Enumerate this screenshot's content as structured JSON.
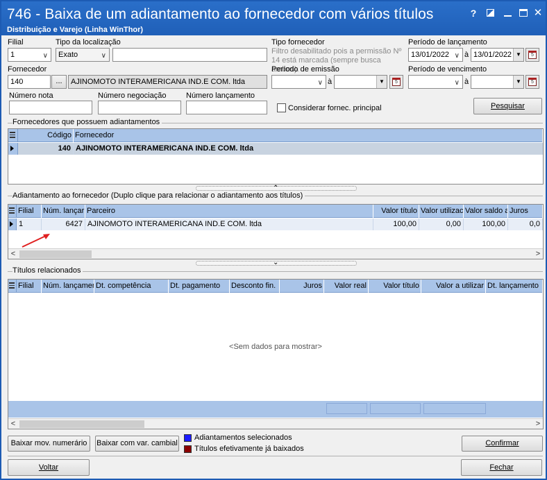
{
  "window": {
    "title": "746 - Baixa de um adiantamento ao fornecedor com vários títulos",
    "subtitle": "Distribuição e Varejo (Linha WinThor)",
    "help_glyph": "?",
    "close_glyph": "✕"
  },
  "filters": {
    "filial_label": "Filial",
    "filial_value": "1",
    "tipo_localizacao_label": "Tipo da localização",
    "tipo_localizacao_value": "Exato",
    "localizacao_value": "",
    "tipo_fornecedor_label": "Tipo fornecedor",
    "tipo_fornecedor_hint": "Filtro desabilitado pois a permissão Nº 14 está marcada (sempre busca ambos).",
    "periodo_lancamento_label": "Período de lançamento",
    "periodo_lancamento_inicio": "13/01/2022",
    "periodo_lancamento_fim": "13/01/2022",
    "a_label": "à",
    "fornecedor_label": "Fornecedor",
    "fornecedor_codigo": "140",
    "ellipsis_button": "...",
    "fornecedor_nome": "AJINOMOTO INTERAMERICANA IND.E COM. ltda",
    "periodo_emissao_label": "Período de emissão",
    "periodo_emissao_inicio": "",
    "periodo_emissao_fim": "",
    "periodo_vencimento_label": "Período de vencimento",
    "periodo_vencimento_inicio": "",
    "periodo_vencimento_fim": "",
    "numero_nota_label": "Número nota",
    "numero_negociacao_label": "Número negociação",
    "numero_lancamento_label": "Número lançamento",
    "considerar_label": "Considerar fornec. principal",
    "pesquisar_button": "Pesquisar"
  },
  "fornecedores": {
    "section_title": "Fornecedores que possuem adiantamentos",
    "columns": [
      "Código",
      "Fornecedor"
    ],
    "rows": [
      {
        "codigo": "140",
        "fornecedor": "AJINOMOTO INTERAMERICANA IND.E COM. ltda"
      }
    ]
  },
  "adiantamentos": {
    "section_title": "Adiantamento ao fornecedor (Duplo clique para relacionar o adiantamento aos títulos)",
    "columns": [
      "Filial",
      "Núm. lançar",
      "Parceiro",
      "Valor título",
      "Valor utilizac",
      "Valor saldo a",
      "Juros"
    ],
    "rows": [
      {
        "filial": "1",
        "num_lancamento": "6427",
        "parceiro": "AJINOMOTO INTERAMERICANA IND.E COM. ltda",
        "valor_titulo": "100,00",
        "valor_utilizado": "0,00",
        "valor_saldo": "100,00",
        "juros": "0,0"
      }
    ]
  },
  "titulos": {
    "section_title": "Títulos relacionados",
    "columns": [
      "Filial",
      "Núm. lançamer",
      "Dt. competência",
      "Dt. pagamento",
      "Desconto fin.",
      "Juros",
      "Valor real",
      "Valor título",
      "Valor a utilizar",
      "Dt. lançamento"
    ],
    "empty_message": "<Sem dados para mostrar>"
  },
  "footer": {
    "baixar_mov_button": "Baixar mov. numerário",
    "baixar_var_button": "Baixar com var. cambial",
    "legend_selected": "Adiantamentos selecionados",
    "legend_baixados": "Títulos efetivamente já baixados",
    "legend_selected_color": "#1a1aff",
    "legend_baixados_color": "#8b0000",
    "confirmar_button": "Confirmar",
    "voltar_button": "Voltar",
    "fechar_button": "Fechar"
  },
  "colors": {
    "titlebar": "#1f5fb8",
    "grid_header": "#a9c4e8",
    "annotation_arrow": "#e02020"
  }
}
